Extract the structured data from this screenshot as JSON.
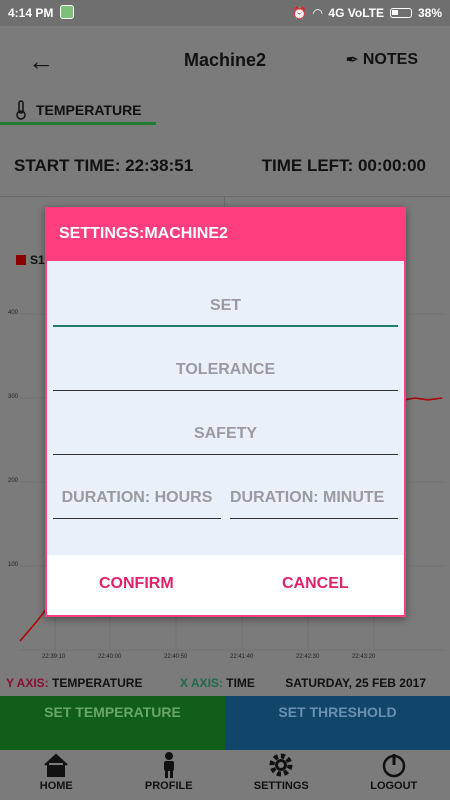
{
  "status_bar": {
    "time": "4:14 PM",
    "network": "4G VoLTE",
    "battery": "38%"
  },
  "appbar": {
    "title": "Machine2",
    "notes_label": "NOTES"
  },
  "tab": {
    "label": "TEMPERATURE"
  },
  "times": {
    "start": "START TIME:  22:38:51",
    "left": "TIME LEFT: 00:00:00"
  },
  "legend": {
    "series_label": "S1"
  },
  "chart_data": {
    "type": "line",
    "y_ticks": [
      "400",
      "300",
      "200",
      "100"
    ],
    "x_ticks": [
      "22:39:10",
      "22:40:00",
      "22:40:50",
      "22:41:40",
      "22:42:30",
      "22:43:20"
    ],
    "series": [
      {
        "name": "S1",
        "color": "#b00000"
      }
    ]
  },
  "axis_info": {
    "y_key": "Y AXIS:",
    "y_value": "TEMPERATURE",
    "x_key": "X AXIS:",
    "x_value": "TIME",
    "date": "SATURDAY, 25 FEB 2017"
  },
  "actions": {
    "set_temperature": "SET TEMPERATURE",
    "set_threshold": "SET THRESHOLD"
  },
  "bottom_nav": {
    "home": "HOME",
    "profile": "PROFILE",
    "settings": "SETTINGS",
    "logout": "LOGOUT"
  },
  "dialog": {
    "title": "SETTINGS:MACHINE2",
    "set_placeholder": "SET",
    "tolerance_placeholder": "TOLERANCE",
    "safety_placeholder": "SAFETY",
    "hours_placeholder": "DURATION: HOURS",
    "minutes_placeholder": "DURATION: MINUTE",
    "confirm": "CONFIRM",
    "cancel": "CANCEL"
  }
}
